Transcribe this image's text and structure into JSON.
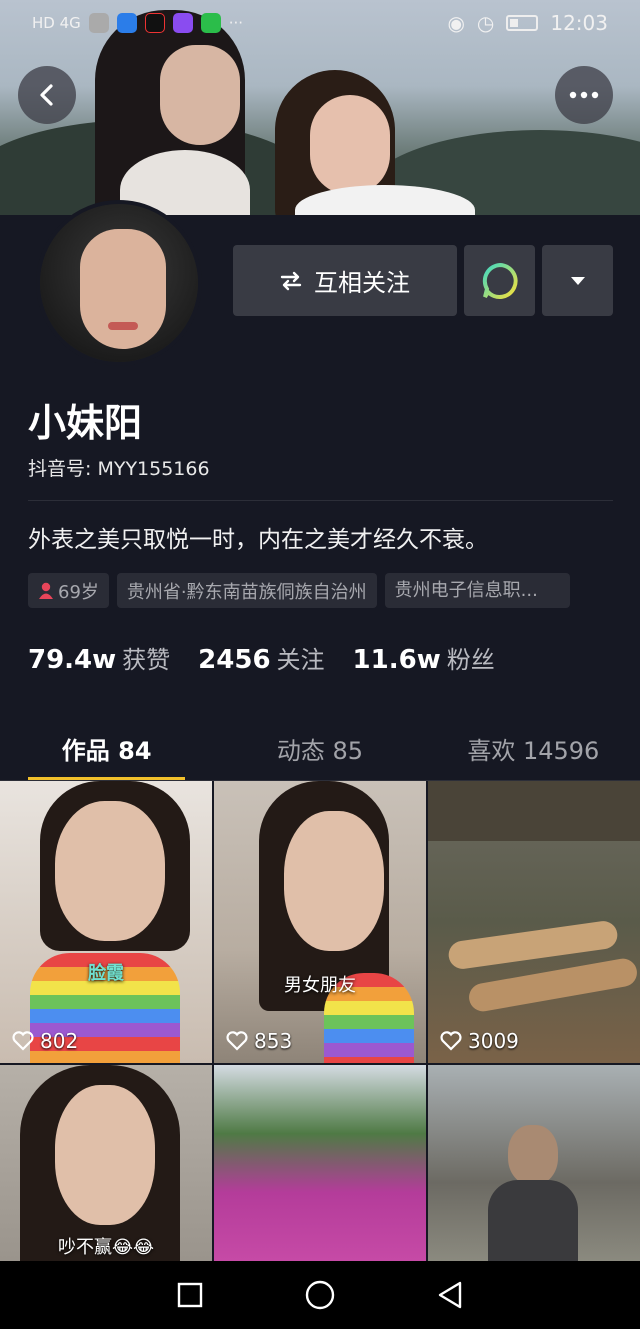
{
  "status_bar": {
    "left_label": "HD 4G",
    "time": "12:03"
  },
  "profile": {
    "name": "小妹阳",
    "douyin_id": "抖音号: MYY155166",
    "bio": "外表之美只取悦一时，内在之美才经久不衰。",
    "follow_button": "互相关注",
    "tags": [
      "69岁",
      "贵州省·黔东南苗族侗族自治州",
      "贵州电子信息职..."
    ]
  },
  "stats": [
    {
      "value": "79.4w",
      "label": "获赞"
    },
    {
      "value": "2456",
      "label": "关注"
    },
    {
      "value": "11.6w",
      "label": "粉丝"
    }
  ],
  "tabs": [
    {
      "label": "作品 84",
      "active": true
    },
    {
      "label": "动态 85",
      "active": false
    },
    {
      "label": "喜欢 14596",
      "active": false
    }
  ],
  "videos": [
    {
      "likes": "802",
      "caption": "脸霞"
    },
    {
      "likes": "853",
      "caption": "男女朋友"
    },
    {
      "likes": "3009",
      "caption": ""
    },
    {
      "likes": "",
      "caption": "吵不赢😂😂"
    },
    {
      "likes": "",
      "caption": ""
    },
    {
      "likes": "",
      "caption": ""
    }
  ],
  "icons": {
    "back": "chevron-left-icon",
    "more": "ellipsis-icon",
    "follow": "swap-arrows-icon",
    "message": "chat-bubble-icon",
    "dropdown": "triangle-down-icon",
    "gender": "person-icon",
    "heart": "heart-outline-icon"
  },
  "colors": {
    "background": "#161823",
    "button": "#393b44",
    "tab_indicator": "#f2c02b",
    "chat_ring": "#3fd8c3"
  }
}
